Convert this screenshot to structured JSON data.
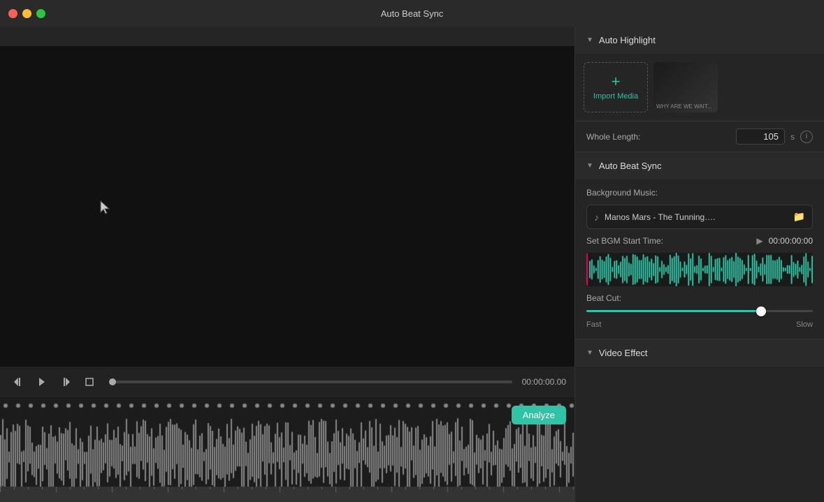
{
  "app": {
    "title": "Auto Beat Sync"
  },
  "titlebar": {
    "dots": [
      "red",
      "yellow",
      "green"
    ]
  },
  "transport": {
    "timecode": "00:00:00.00"
  },
  "right_panel": {
    "auto_highlight": {
      "label": "Auto Highlight",
      "import_label": "Import Media",
      "whole_length_label": "Whole Length:",
      "whole_length_value": "105",
      "unit": "s"
    },
    "auto_beat_sync": {
      "label": "Auto Beat Sync",
      "bg_music_label": "Background Music:",
      "track_name": "Manos Mars - The Tunning….",
      "set_bgm_start_label": "Set BGM Start Time:",
      "bgm_timecode": "00:00:00:00",
      "beat_cut_label": "Beat Cut:",
      "beat_cut_fast": "Fast",
      "beat_cut_slow": "Slow",
      "slider_percent": 75,
      "analyze_label": "Analyze"
    },
    "video_effect": {
      "label": "Video Effect"
    }
  }
}
